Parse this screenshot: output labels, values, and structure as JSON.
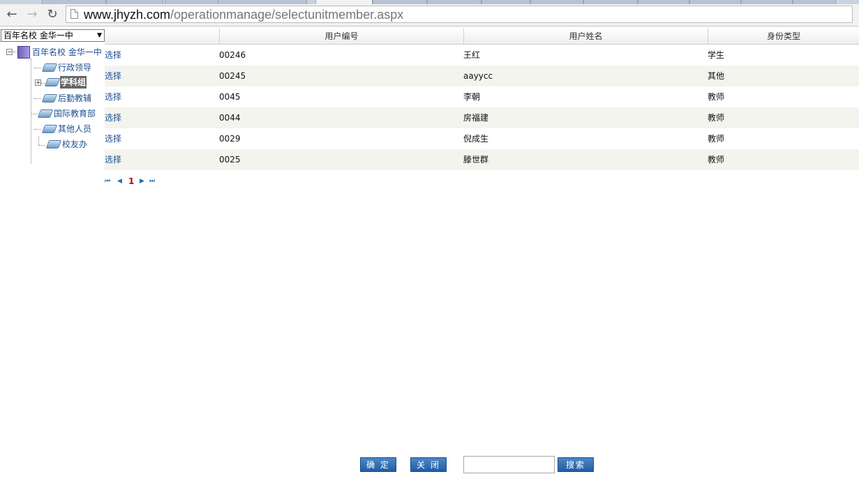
{
  "browser": {
    "url_host": "www.jhyzh.com",
    "url_path": "/operationmanage/selectunitmember.aspx",
    "nav": {
      "back": "←",
      "forward": "→",
      "reload": "↻"
    }
  },
  "sidebar": {
    "unit_select": "百年名校 金华一中",
    "tree": {
      "root": "百年名校 金华一中",
      "children": [
        "行政领导",
        "学科组",
        "后勤教辅",
        "国际教育部",
        "其他人员",
        "校友办"
      ],
      "selected": "学科组"
    }
  },
  "grid": {
    "headers": [
      "用户编号",
      "用户姓名",
      "身份类型"
    ],
    "select_label": "选择",
    "rows": [
      {
        "id": "00246",
        "name": "王红",
        "type": "学生"
      },
      {
        "id": "00245",
        "name": "aayycc",
        "type": "其他"
      },
      {
        "id": "0045",
        "name": "李朝",
        "type": "教师"
      },
      {
        "id": "0044",
        "name": "房福建",
        "type": "教师"
      },
      {
        "id": "0029",
        "name": "倪成生",
        "type": "教师"
      },
      {
        "id": "0025",
        "name": "滕世群",
        "type": "教师"
      }
    ]
  },
  "pager": {
    "first": "⏮",
    "prev": "◀",
    "current_page": "1",
    "next": "▶",
    "last": "⏭"
  },
  "footer": {
    "confirm_label": "确 定",
    "close_label": "关 闭",
    "search_value": "",
    "search_label": "搜索"
  }
}
